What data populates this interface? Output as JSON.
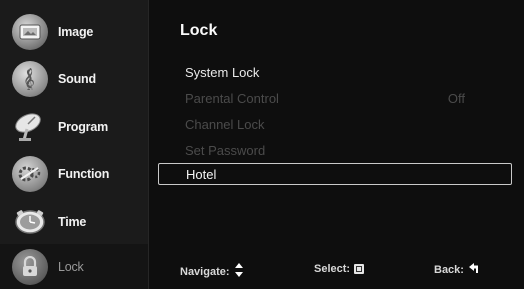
{
  "sidebar": {
    "items": [
      {
        "label": "Image",
        "icon": "image-icon"
      },
      {
        "label": "Sound",
        "icon": "sound-icon"
      },
      {
        "label": "Program",
        "icon": "satellite-dish-icon"
      },
      {
        "label": "Function",
        "icon": "function-icon"
      },
      {
        "label": "Time",
        "icon": "clock-icon"
      },
      {
        "label": "Lock",
        "icon": "lock-icon"
      }
    ],
    "active_index": 5
  },
  "main": {
    "title": "Lock",
    "items": [
      {
        "label": "System Lock",
        "value": "",
        "state": "enabled"
      },
      {
        "label": "Parental Control",
        "value": "Off",
        "state": "disabled"
      },
      {
        "label": "Channel Lock",
        "value": "",
        "state": "disabled"
      },
      {
        "label": "Set Password",
        "value": "",
        "state": "disabled"
      },
      {
        "label": "Hotel",
        "value": "",
        "state": "selected"
      }
    ]
  },
  "hints": {
    "navigate": "Navigate:",
    "select": "Select:",
    "back": "Back:"
  },
  "colors": {
    "sidebar_bg": "#1b1b1b",
    "main_bg": "#0e0e0e",
    "disabled_text": "#4b4b4b",
    "selection_border": "#c9c9c9"
  }
}
